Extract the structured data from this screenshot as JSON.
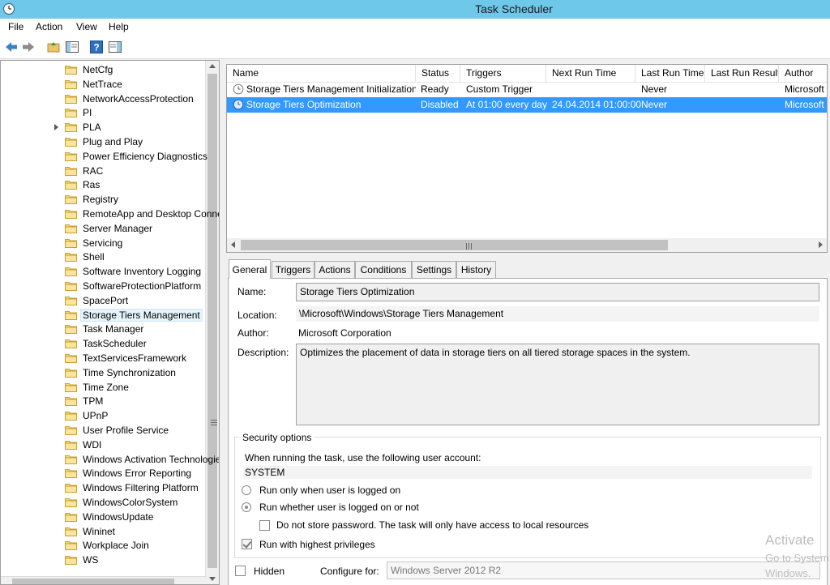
{
  "window": {
    "title": "Task Scheduler"
  },
  "menu": [
    "File",
    "Action",
    "View",
    "Help"
  ],
  "toolbar": [
    "back-icon",
    "forward-icon",
    "up-folder-icon",
    "show-hide-tree-icon",
    "help-icon",
    "show-hide-action-pane-icon"
  ],
  "tree": {
    "items": [
      {
        "label": "NetCfg"
      },
      {
        "label": "NetTrace"
      },
      {
        "label": "NetworkAccessProtection"
      },
      {
        "label": "PI"
      },
      {
        "label": "PLA"
      },
      {
        "label": "Plug and Play"
      },
      {
        "label": "Power Efficiency Diagnostics"
      },
      {
        "label": "RAC"
      },
      {
        "label": "Ras"
      },
      {
        "label": "Registry"
      },
      {
        "label": "RemoteApp and Desktop Connections Management"
      },
      {
        "label": "Server Manager"
      },
      {
        "label": "Servicing"
      },
      {
        "label": "Shell"
      },
      {
        "label": "Software Inventory Logging"
      },
      {
        "label": "SoftwareProtectionPlatform"
      },
      {
        "label": "SpacePort"
      },
      {
        "label": "Storage Tiers Management"
      },
      {
        "label": "Task Manager"
      },
      {
        "label": "TaskScheduler"
      },
      {
        "label": "TextServicesFramework"
      },
      {
        "label": "Time Synchronization"
      },
      {
        "label": "Time Zone"
      },
      {
        "label": "TPM"
      },
      {
        "label": "UPnP"
      },
      {
        "label": "User Profile Service"
      },
      {
        "label": "WDI"
      },
      {
        "label": "Windows Activation Technologies"
      },
      {
        "label": "Windows Error Reporting"
      },
      {
        "label": "Windows Filtering Platform"
      },
      {
        "label": "WindowsColorSystem"
      },
      {
        "label": "WindowsUpdate"
      },
      {
        "label": "Wininet"
      },
      {
        "label": "Workplace Join"
      },
      {
        "label": "WS"
      }
    ],
    "selected_index": 17,
    "expandable_index": 4
  },
  "tasks": {
    "columns": [
      "Name",
      "Status",
      "Triggers",
      "Next Run Time",
      "Last Run Time",
      "Last Run Result",
      "Author"
    ],
    "rows": [
      {
        "name": "Storage Tiers Management Initialization",
        "status": "Ready",
        "triggers": "Custom Trigger",
        "next_run": "",
        "last_run": "Never",
        "last_result": "",
        "author": "Microsoft"
      },
      {
        "name": "Storage Tiers Optimization",
        "status": "Disabled",
        "triggers": "At 01:00 every day",
        "next_run": "24.04.2014 01:00:00",
        "last_run": "Never",
        "last_result": "",
        "author": "Microsoft"
      }
    ],
    "selected_index": 1
  },
  "tabs": [
    "General",
    "Triggers",
    "Actions",
    "Conditions",
    "Settings",
    "History"
  ],
  "active_tab": "General",
  "general": {
    "name_label": "Name:",
    "name": "Storage Tiers Optimization",
    "location_label": "Location:",
    "location": "\\Microsoft\\Windows\\Storage Tiers Management",
    "author_label": "Author:",
    "author": "Microsoft Corporation",
    "description_label": "Description:",
    "description": "Optimizes the placement of data in storage tiers on all tiered storage spaces in the system."
  },
  "security": {
    "title": "Security options",
    "account_prompt": "When running the task, use the following user account:",
    "account": "SYSTEM",
    "run_logged_on": "Run only when user is logged on",
    "run_whether": "Run whether user is logged on or not",
    "no_store_password": "Do not store password.  The task will only have access to local resources",
    "highest_privileges": "Run with highest privileges",
    "selected_mode": "run_whether",
    "no_store_password_checked": false,
    "highest_privileges_checked": true
  },
  "bottom": {
    "hidden_label": "Hidden",
    "hidden_checked": false,
    "configure_label": "Configure for:",
    "configure_value": "Windows Server 2012 R2"
  },
  "watermark": {
    "line1": "Activate",
    "line2": "Go to System",
    "line3": "Windows."
  }
}
